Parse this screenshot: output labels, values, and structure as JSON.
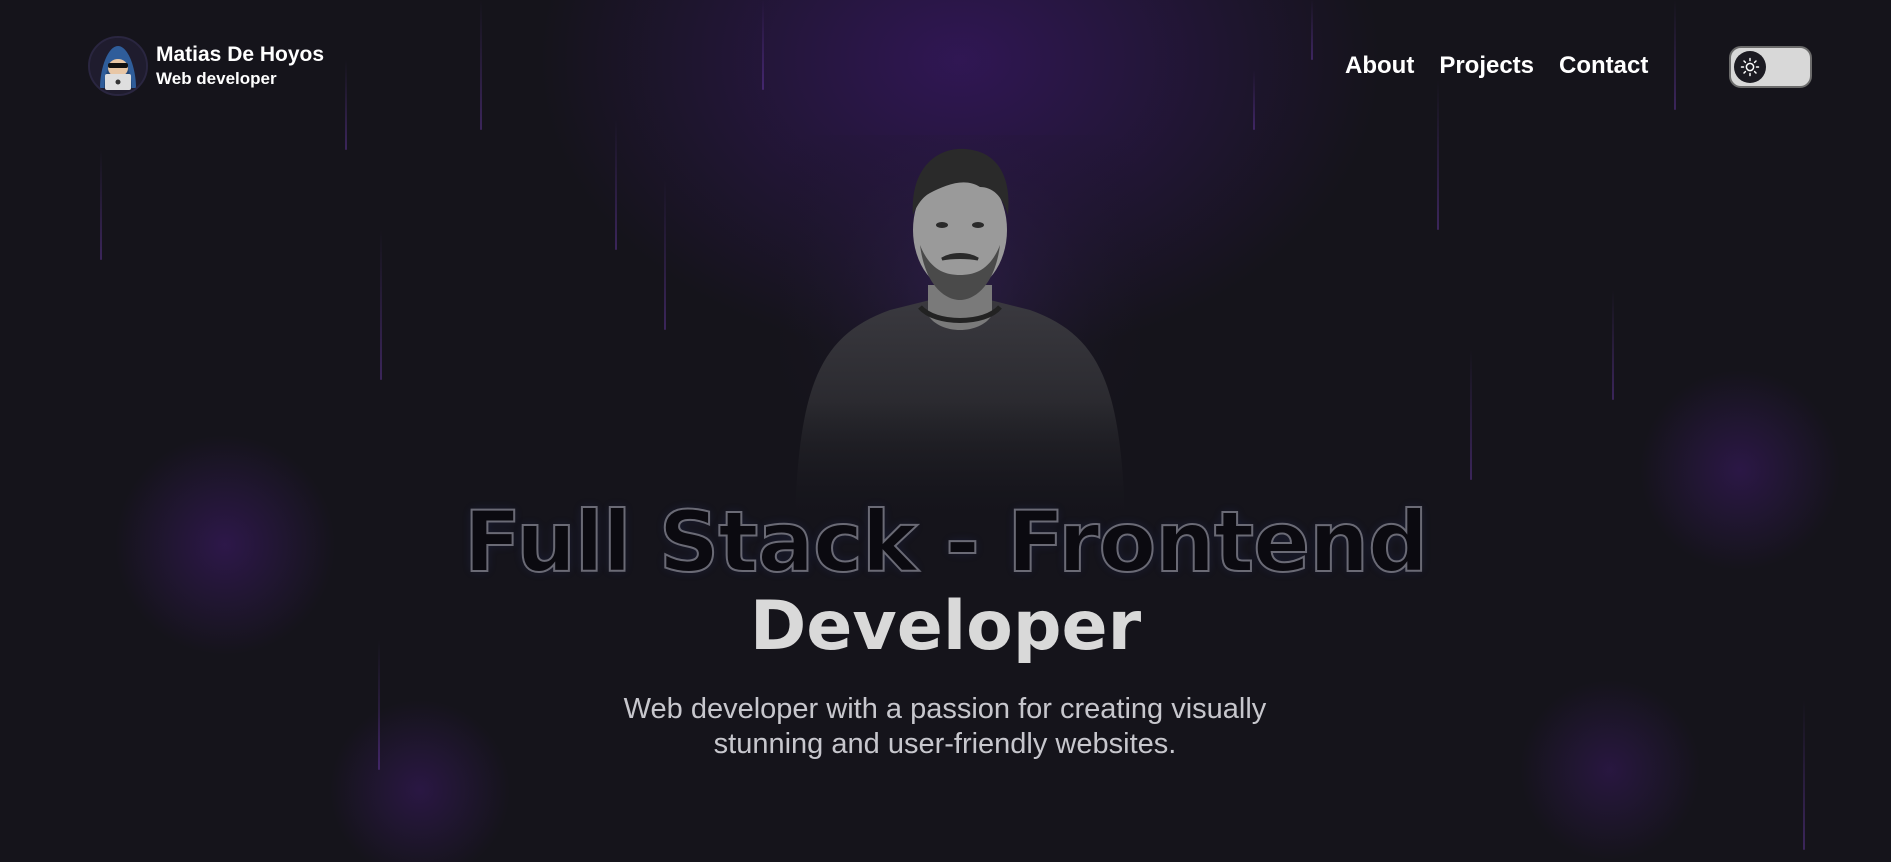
{
  "header": {
    "name": "Matias De Hoyos",
    "role": "Web developer",
    "avatar_icon": "hacker-avatar-icon",
    "nav": [
      {
        "label": "About"
      },
      {
        "label": "Projects"
      },
      {
        "label": "Contact"
      }
    ],
    "theme_toggle": {
      "icon": "sun-icon",
      "state": "dark"
    }
  },
  "hero": {
    "title_line1": "Full Stack - Frontend",
    "title_line2": "Developer",
    "tagline": "Web developer with a passion for creating visually stunning and user-friendly websites."
  },
  "colors": {
    "background": "#15141b",
    "accent_glow": "#5a1ea0",
    "text": "#ffffff",
    "muted_text": "#c7c7cd"
  }
}
